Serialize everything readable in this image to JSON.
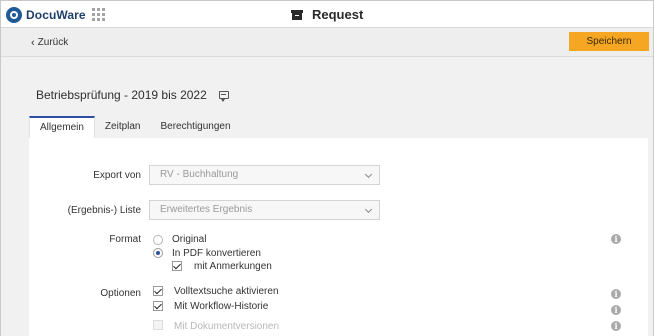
{
  "app": {
    "brand": "DocuWare",
    "window_title": "Request"
  },
  "toolbar": {
    "back_label": "Zurück",
    "save_label": "Speichern"
  },
  "document": {
    "title": "Betriebsprüfung - 2019 bis 2022"
  },
  "tabs": [
    {
      "label": "Allgemein",
      "active": true
    },
    {
      "label": "Zeitplan",
      "active": false
    },
    {
      "label": "Berechtigungen",
      "active": false
    }
  ],
  "form": {
    "export_from": {
      "label": "Export von",
      "value": "RV - Buchhaltung"
    },
    "result_list": {
      "label": "(Ergebnis-) Liste",
      "value": "Erweitertes Ergebnis"
    },
    "format": {
      "label": "Format",
      "options": [
        {
          "label": "Original",
          "selected": false
        },
        {
          "label": "In PDF konvertieren",
          "selected": true
        }
      ],
      "sub_option": {
        "label": "mit Anmerkungen",
        "checked": true
      }
    },
    "options": {
      "label": "Optionen",
      "items": [
        {
          "label": "Volltextsuche aktivieren",
          "checked": true,
          "disabled": false
        },
        {
          "label": "Mit Workflow-Historie",
          "checked": true,
          "disabled": false
        },
        {
          "label": "Mit Dokumentversionen",
          "checked": false,
          "disabled": true
        }
      ]
    }
  },
  "colors": {
    "accent": "#2d4fa0",
    "save_button": "#f5a623",
    "brand": "#1f5a99"
  },
  "icons": [
    "logo-icon",
    "app-grid-icon",
    "archive-box-icon",
    "chevron-left-icon",
    "comment-icon",
    "chevron-down-icon",
    "info-icon"
  ]
}
